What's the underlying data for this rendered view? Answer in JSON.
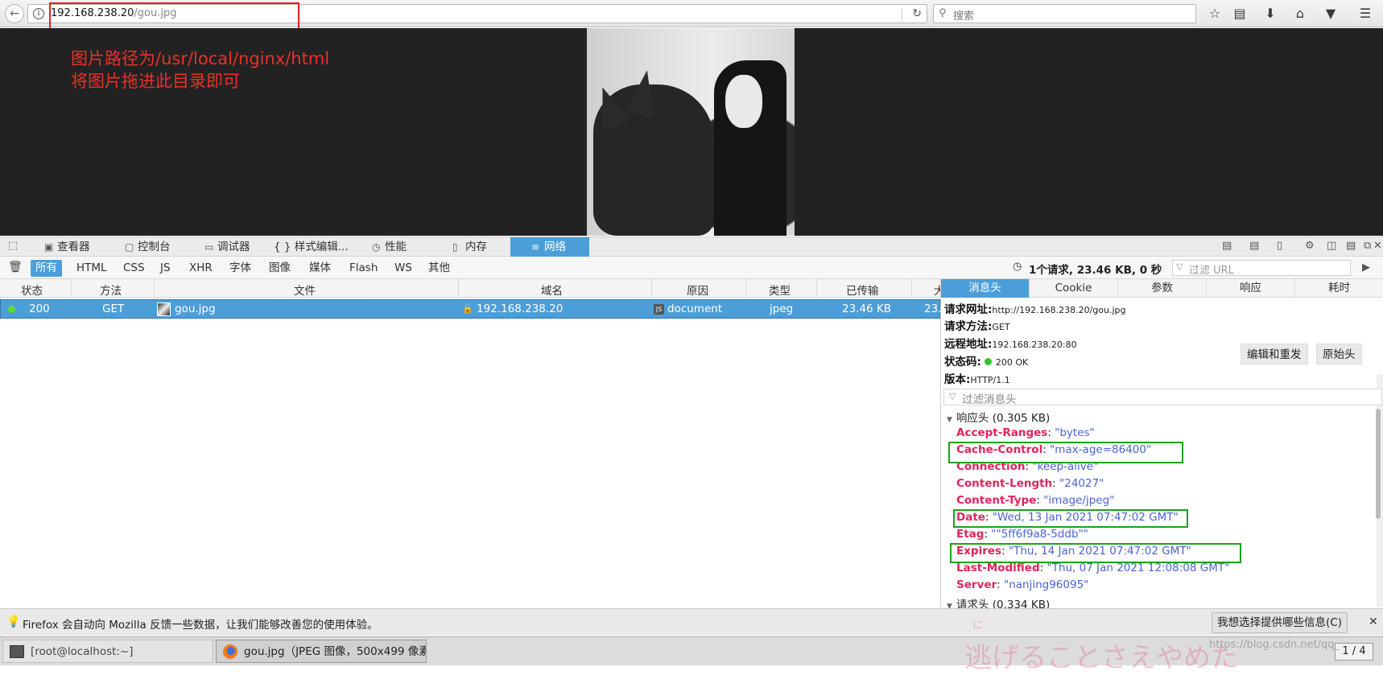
{
  "browser": {
    "url_host": "192.168.238.20",
    "url_path": "/gou.jpg",
    "search_placeholder": "搜索"
  },
  "content": {
    "annotation_line1": "图片路径为/usr/local/nginx/html",
    "annotation_line2": "将图片拖进此目录即可"
  },
  "devtools": {
    "tabs": [
      "查看器",
      "控制台",
      "调试器",
      "{ } 样式编辑...",
      "性能",
      "内存",
      "网络"
    ],
    "active_tab": "网络",
    "filters": [
      "所有",
      "HTML",
      "CSS",
      "JS",
      "XHR",
      "字体",
      "图像",
      "媒体",
      "Flash",
      "WS",
      "其他"
    ],
    "active_filter": "所有",
    "summary": "1个请求, 23.46 KB, 0 秒",
    "filter_url_placeholder": "过滤 URL"
  },
  "requests": {
    "columns": [
      "状态",
      "方法",
      "文件",
      "域名",
      "原因",
      "类型",
      "已传输",
      "大"
    ],
    "rows": [
      {
        "status": "200",
        "method": "GET",
        "file": "gou.jpg",
        "domain": "192.168.238.20",
        "cause": "document",
        "type": "jpeg",
        "transferred": "23.46 KB",
        "size": "23."
      }
    ]
  },
  "details": {
    "tabs": [
      "消息头",
      "Cookie",
      "参数",
      "响应",
      "耗时"
    ],
    "active_tab": "消息头",
    "request_url_label": "请求网址:",
    "request_url": "http://192.168.238.20/gou.jpg",
    "request_method_label": "请求方法:",
    "request_method": "GET",
    "remote_address_label": "远程地址:",
    "remote_address": "192.168.238.20:80",
    "status_code_label": "状态码:",
    "status_code": "200 OK",
    "version_label": "版本:",
    "version": "HTTP/1.1",
    "edit_resend_button": "编辑和重发",
    "raw_headers_button": "原始头",
    "filter_headers_placeholder": "过滤消息头",
    "response_headers_title": "响应头 (0.305 KB)",
    "response_headers": [
      {
        "name": "Accept-Ranges",
        "value": "\"bytes\""
      },
      {
        "name": "Cache-Control",
        "value": "\"max-age=86400\""
      },
      {
        "name": "Connection",
        "value": "\"keep-alive\""
      },
      {
        "name": "Content-Length",
        "value": "\"24027\""
      },
      {
        "name": "Content-Type",
        "value": "\"image/jpeg\""
      },
      {
        "name": "Date",
        "value": "\"Wed, 13 Jan 2021 07:47:02 GMT\""
      },
      {
        "name": "Etag",
        "value": "\"\"5ff6f9a8-5ddb\"\""
      },
      {
        "name": "Expires",
        "value": "\"Thu, 14 Jan 2021 07:47:02 GMT\""
      },
      {
        "name": "Last-Modified",
        "value": "\"Thu, 07 Jan 2021 12:08:08 GMT\""
      },
      {
        "name": "Server",
        "value": "\"nanjing96095\""
      }
    ],
    "request_headers_title": "请求头 (0.334 KB)"
  },
  "notification": {
    "text": "Firefox 会自动向 Mozilla 反馈一些数据，让我们能够改善您的使用体验。",
    "button": "我想选择提供哪些信息(C)"
  },
  "taskbar": {
    "tasks": [
      "[root@localhost:~]",
      "gou.jpg（JPEG 图像，500x499 像素..."
    ],
    "pager": "1 / 4"
  },
  "watermarks": {
    "url": "https://blog.csdn.net/qq_",
    "japanese": "逃げることさえやめた",
    "small": "に"
  },
  "colors": {
    "accent": "#4c9ed9",
    "header_name": "#e3245c",
    "header_value": "#4a63d6",
    "highlight_red": "#e02020",
    "highlight_green": "#1ca31c"
  }
}
